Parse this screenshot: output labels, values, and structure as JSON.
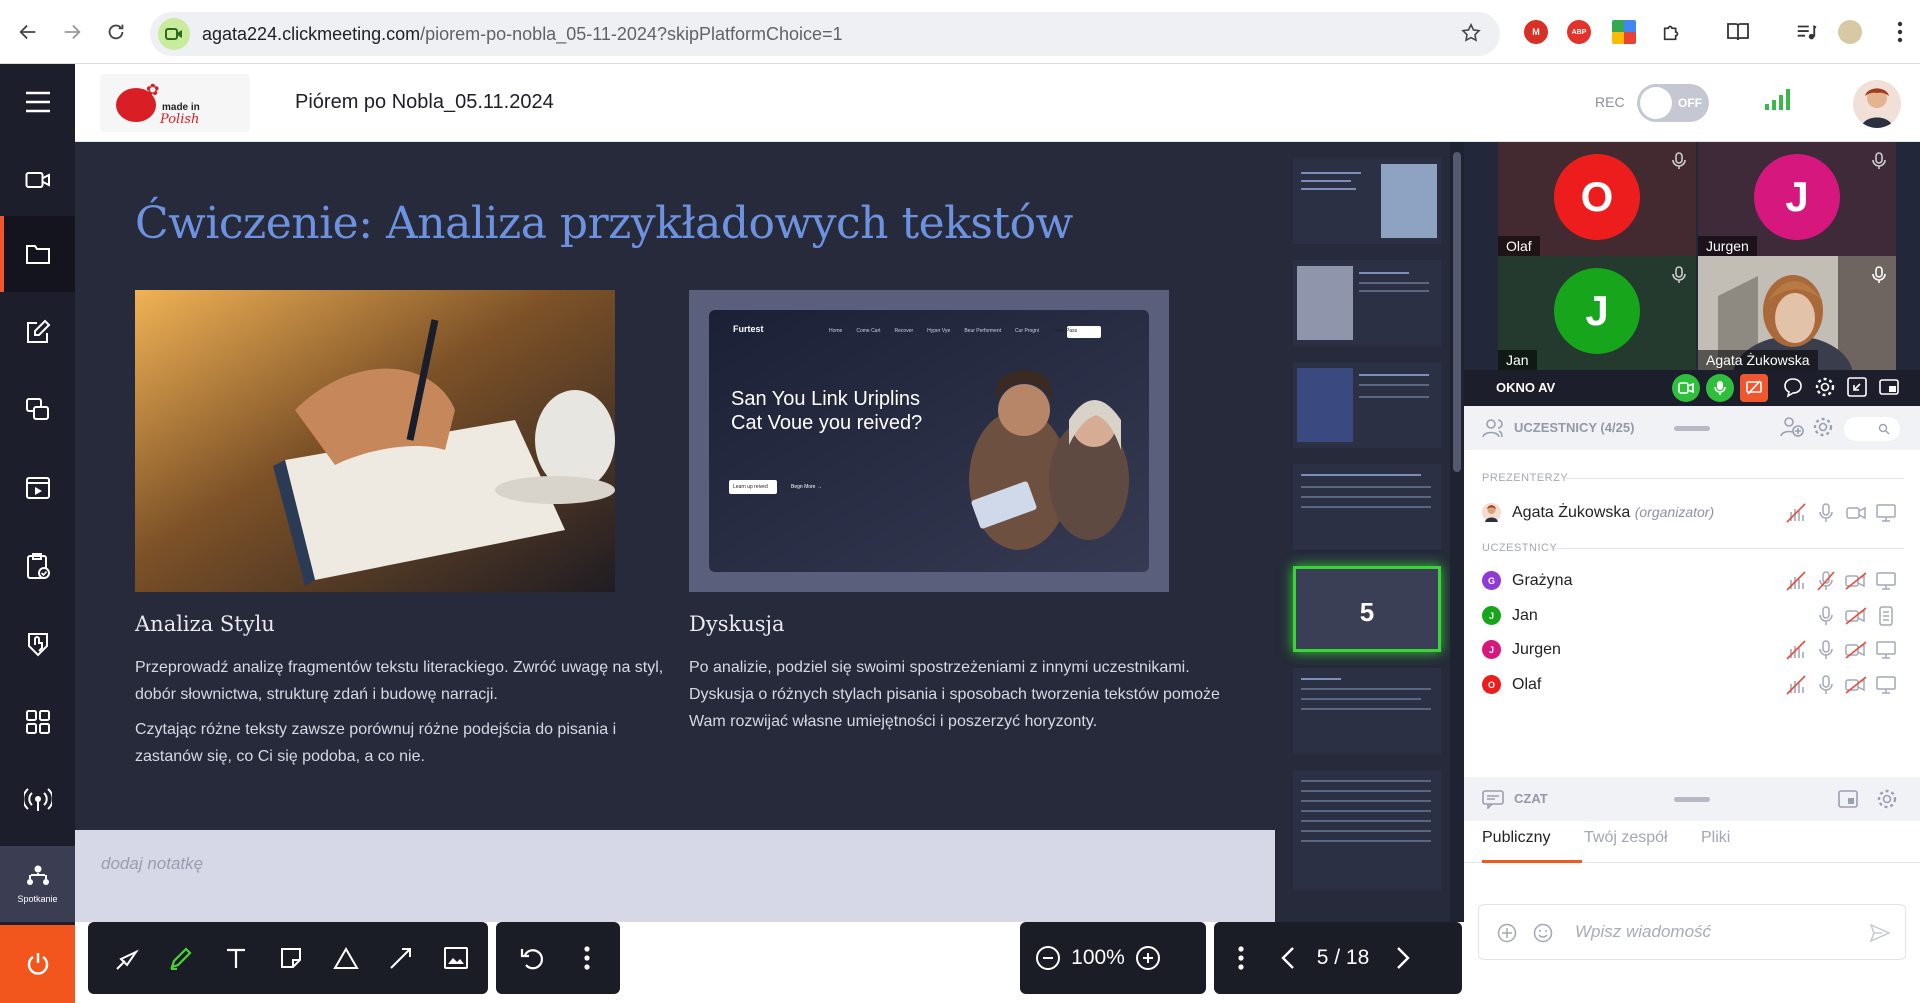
{
  "browser": {
    "url_host": "agata224.clickmeeting.com",
    "url_path": "/piorem-po-nobla_05-11-2024?skipPlatformChoice=1",
    "extensions": [
      {
        "name": "M",
        "color": "#d93025"
      },
      {
        "name": "ABP",
        "color": "#e2322c"
      }
    ]
  },
  "header": {
    "logo_line1": "made in",
    "logo_line2": "Polish",
    "meeting_title": "Piórem po Nobla_05.11.2024",
    "rec_label": "REC",
    "rec_state": "OFF"
  },
  "sidebar": {
    "meeting_label": "Spotkanie"
  },
  "slide": {
    "title": "Ćwiczenie: Analiza przykładowych tekstów",
    "web_image": {
      "brand": "Furtest",
      "nav": [
        "Home",
        "Come Cart",
        "Recover",
        "Hyper Vye",
        "Beur Performent",
        "Cur Progni",
        "Clerk Pass"
      ],
      "headline1": "San You Link Uriplins",
      "headline2": "Cat Voue you reived?",
      "btn1": "Learn up reived",
      "btn2": "Begn More →"
    },
    "left_heading": "Analiza Stylu",
    "left_p1": "Przeprowadź analizę fragmentów tekstu literackiego. Zwróć uwagę na styl, dobór słownictwa, strukturę zdań i budowę narracji.",
    "left_p2": "Czytając różne teksty zawsze porównuj różne podejścia do pisania i zastanów się, co Ci się podoba, a co nie.",
    "right_heading": "Dyskusja",
    "right_p1": "Po analizie, podziel się swoimi spostrzeżeniami z innymi uczestnikami. Dyskusja o różnych stylach pisania i sposobach tworzenia tekstów pomoże Wam rozwijać własne umiejętności i poszerzyć horyzonty."
  },
  "thumbnails": {
    "active_number": "5"
  },
  "notes": {
    "placeholder": "dodaj notatkę"
  },
  "toolbar": {
    "zoom": "100%",
    "page": "5 / 18"
  },
  "video": {
    "tiles": [
      {
        "name": "Olaf",
        "initial": "O",
        "color": "#ee1d1d"
      },
      {
        "name": "Jurgen",
        "initial": "J",
        "color": "#d5177e"
      },
      {
        "name": "Jan",
        "initial": "J",
        "color": "#17a51c"
      },
      {
        "name": "Agata Żukowska",
        "initial": "",
        "color": "#c8b8a0"
      }
    ],
    "av_label": "OKNO AV"
  },
  "participants": {
    "title": "UCZESTNICY (4/25)",
    "presenters_label": "PREZENTERZY",
    "attendees_label": "UCZESTNICY",
    "presenter": {
      "name": "Agata Żukowska",
      "role": "(organizator)"
    },
    "attendees": [
      {
        "name": "Grażyna",
        "initial": "G",
        "color": "#8e3ad6"
      },
      {
        "name": "Jan",
        "initial": "J",
        "color": "#17a51c"
      },
      {
        "name": "Jurgen",
        "initial": "J",
        "color": "#d5177e"
      },
      {
        "name": "Olaf",
        "initial": "O",
        "color": "#ee1d1d"
      }
    ]
  },
  "chat": {
    "title": "CZAT",
    "tabs": [
      "Publiczny",
      "Twój zespół",
      "Pliki"
    ],
    "input_placeholder": "Wpisz wiadomość"
  }
}
